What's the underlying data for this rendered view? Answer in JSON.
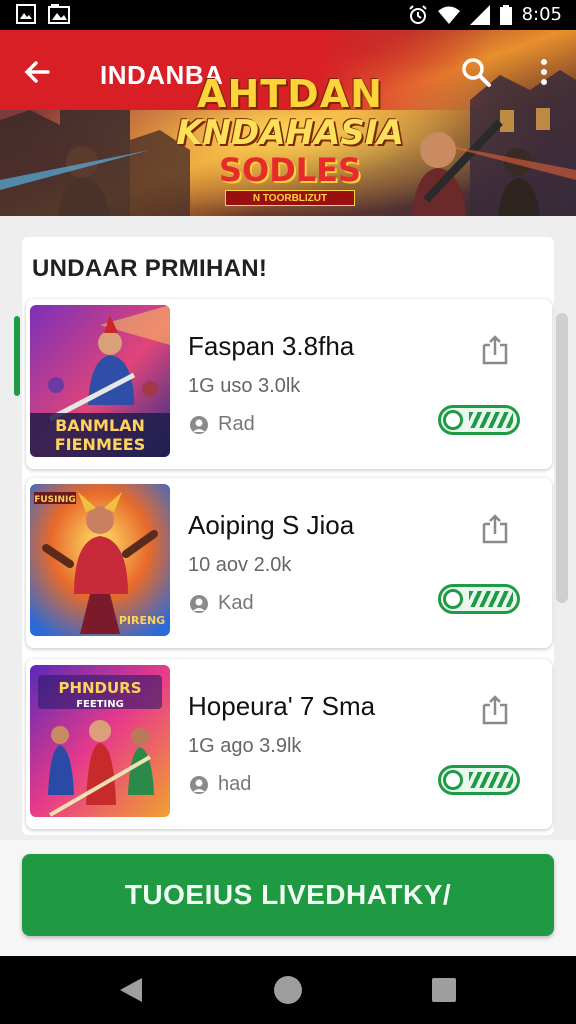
{
  "status_bar": {
    "time": "8:05",
    "icons": [
      "gallery-icon",
      "image-icon",
      "alarm-icon",
      "wifi-icon",
      "signal-icon",
      "battery-icon"
    ]
  },
  "header": {
    "title": "INDANBA",
    "logo": {
      "line1": "AHTDAN",
      "line2": "KNDAHASIA",
      "line3": "SODLES",
      "tag": "N TOORBLIZUT"
    },
    "icons": [
      "back-arrow-icon",
      "search-icon",
      "more-vert-icon"
    ]
  },
  "section": {
    "title": "UNDAAR PRMIHAN!"
  },
  "items": [
    {
      "title": "Faspan 3.8fha",
      "meta": "1G uso 3.0lk",
      "status": "Rad",
      "thumb_caption_1": "BANMLAN",
      "thumb_caption_2": "FIENMEES"
    },
    {
      "title": "Aoiping S Jioa",
      "meta": "10 aov 2.0k",
      "status": "Kad",
      "thumb_caption_1": "FUSINIG",
      "thumb_caption_2": "PIRENG"
    },
    {
      "title": "Hopeura' 7 Sma",
      "meta": "1G ago 3.9lk",
      "status": "had",
      "thumb_caption_1": "PHNDURS",
      "thumb_caption_2": "FEETING"
    }
  ],
  "primary_action": {
    "label": "TUOEIUS LIVEDHATKY/"
  },
  "colors": {
    "accent_green": "#1e9b44",
    "header_red": "#d81f26",
    "status_bar": "#000000"
  }
}
